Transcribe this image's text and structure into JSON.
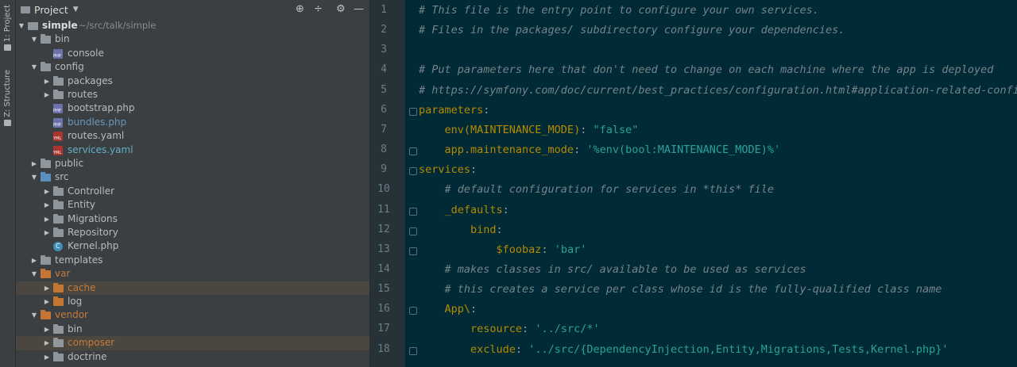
{
  "side_tabs": [
    {
      "label": "1: Project"
    },
    {
      "label": "Z: Structure"
    }
  ],
  "project_panel": {
    "title": "Project",
    "tree": [
      {
        "label": "simple",
        "path": "~/src/talk/simple",
        "type": "project",
        "depth": 0,
        "expanded": true,
        "bold": true
      },
      {
        "label": "bin",
        "type": "folder",
        "depth": 1,
        "expanded": true
      },
      {
        "label": "console",
        "type": "php",
        "depth": 2
      },
      {
        "label": "config",
        "type": "folder",
        "depth": 1,
        "expanded": true
      },
      {
        "label": "packages",
        "type": "folder",
        "depth": 2,
        "expanded": false
      },
      {
        "label": "routes",
        "type": "folder",
        "depth": 2,
        "expanded": false
      },
      {
        "label": "bootstrap.php",
        "type": "php",
        "depth": 2
      },
      {
        "label": "bundles.php",
        "type": "php",
        "depth": 2,
        "color": "blue"
      },
      {
        "label": "routes.yaml",
        "type": "yml",
        "depth": 2
      },
      {
        "label": "services.yaml",
        "type": "yml",
        "depth": 2,
        "color": "teal"
      },
      {
        "label": "public",
        "type": "folder",
        "depth": 1,
        "expanded": false
      },
      {
        "label": "src",
        "type": "folder-blue",
        "depth": 1,
        "expanded": true
      },
      {
        "label": "Controller",
        "type": "folder",
        "depth": 2,
        "expanded": false
      },
      {
        "label": "Entity",
        "type": "folder",
        "depth": 2,
        "expanded": false
      },
      {
        "label": "Migrations",
        "type": "folder",
        "depth": 2,
        "expanded": false
      },
      {
        "label": "Repository",
        "type": "folder",
        "depth": 2,
        "expanded": false
      },
      {
        "label": "Kernel.php",
        "type": "class",
        "depth": 2
      },
      {
        "label": "templates",
        "type": "folder",
        "depth": 1,
        "expanded": false
      },
      {
        "label": "var",
        "type": "folder-orange",
        "depth": 1,
        "expanded": true,
        "color": "orange"
      },
      {
        "label": "cache",
        "type": "folder-orange",
        "depth": 2,
        "expanded": false,
        "color": "orange",
        "selected": true
      },
      {
        "label": "log",
        "type": "folder-orange",
        "depth": 2,
        "expanded": false
      },
      {
        "label": "vendor",
        "type": "folder-orange",
        "depth": 1,
        "expanded": true,
        "color": "orange"
      },
      {
        "label": "bin",
        "type": "folder",
        "depth": 2,
        "expanded": false
      },
      {
        "label": "composer",
        "type": "folder",
        "depth": 2,
        "expanded": false,
        "color": "orange",
        "selected": true
      },
      {
        "label": "doctrine",
        "type": "folder",
        "depth": 2,
        "expanded": false
      }
    ]
  },
  "editor": {
    "lines": [
      {
        "n": "1",
        "tokens": [
          {
            "t": "# This file is the entry point to configure your own services.",
            "c": "cm"
          }
        ]
      },
      {
        "n": "2",
        "tokens": [
          {
            "t": "# Files in the packages/ subdirectory configure your dependencies.",
            "c": "cm"
          }
        ]
      },
      {
        "n": "3",
        "tokens": []
      },
      {
        "n": "4",
        "tokens": [
          {
            "t": "# Put parameters here that don't need to change on each machine where the app is deployed",
            "c": "cm"
          }
        ]
      },
      {
        "n": "5",
        "tokens": [
          {
            "t": "# https://symfony.com/doc/current/best_practices/configuration.html#application-related-configuration",
            "c": "cm"
          }
        ]
      },
      {
        "n": "6",
        "tokens": [
          {
            "t": "parameters",
            "c": "ky"
          },
          {
            "t": ":",
            "c": "pl"
          }
        ]
      },
      {
        "n": "7",
        "tokens": [
          {
            "t": "    env(MAINTENANCE_MODE)",
            "c": "ky"
          },
          {
            "t": ": ",
            "c": "pl"
          },
          {
            "t": "\"false\"",
            "c": "st"
          }
        ]
      },
      {
        "n": "8",
        "tokens": [
          {
            "t": "    app.maintenance_mode",
            "c": "ky"
          },
          {
            "t": ": ",
            "c": "pl"
          },
          {
            "t": "'%env(bool:MAINTENANCE_MODE)%'",
            "c": "st"
          }
        ]
      },
      {
        "n": "9",
        "tokens": [
          {
            "t": "services",
            "c": "ky"
          },
          {
            "t": ":",
            "c": "pl"
          }
        ]
      },
      {
        "n": "10",
        "tokens": [
          {
            "t": "    # default configuration for services in *this* file",
            "c": "cm"
          }
        ]
      },
      {
        "n": "11",
        "tokens": [
          {
            "t": "    _defaults",
            "c": "ky"
          },
          {
            "t": ":",
            "c": "pl"
          }
        ]
      },
      {
        "n": "12",
        "tokens": [
          {
            "t": "        bind",
            "c": "ky"
          },
          {
            "t": ":",
            "c": "pl"
          }
        ]
      },
      {
        "n": "13",
        "tokens": [
          {
            "t": "            $foobaz",
            "c": "ky"
          },
          {
            "t": ": ",
            "c": "pl"
          },
          {
            "t": "'bar'",
            "c": "st"
          }
        ]
      },
      {
        "n": "14",
        "tokens": [
          {
            "t": "    # makes classes in src/ available to be used as services",
            "c": "cm"
          }
        ]
      },
      {
        "n": "15",
        "tokens": [
          {
            "t": "    # this creates a service per class whose id is the fully-qualified class name",
            "c": "cm"
          }
        ]
      },
      {
        "n": "16",
        "tokens": [
          {
            "t": "    App\\",
            "c": "ky"
          },
          {
            "t": ":",
            "c": "pl"
          }
        ]
      },
      {
        "n": "17",
        "tokens": [
          {
            "t": "        resource",
            "c": "ky"
          },
          {
            "t": ": ",
            "c": "pl"
          },
          {
            "t": "'../src/*'",
            "c": "st"
          }
        ]
      },
      {
        "n": "18",
        "tokens": [
          {
            "t": "        exclude",
            "c": "ky"
          },
          {
            "t": ": ",
            "c": "pl"
          },
          {
            "t": "'../src/{DependencyInjection,Entity,Migrations,Tests,Kernel.php}'",
            "c": "st"
          }
        ]
      }
    ],
    "changed_lines": [
      7,
      8,
      12,
      13
    ],
    "fold_lines": [
      6,
      8,
      9,
      11,
      12,
      13,
      16,
      18
    ]
  }
}
